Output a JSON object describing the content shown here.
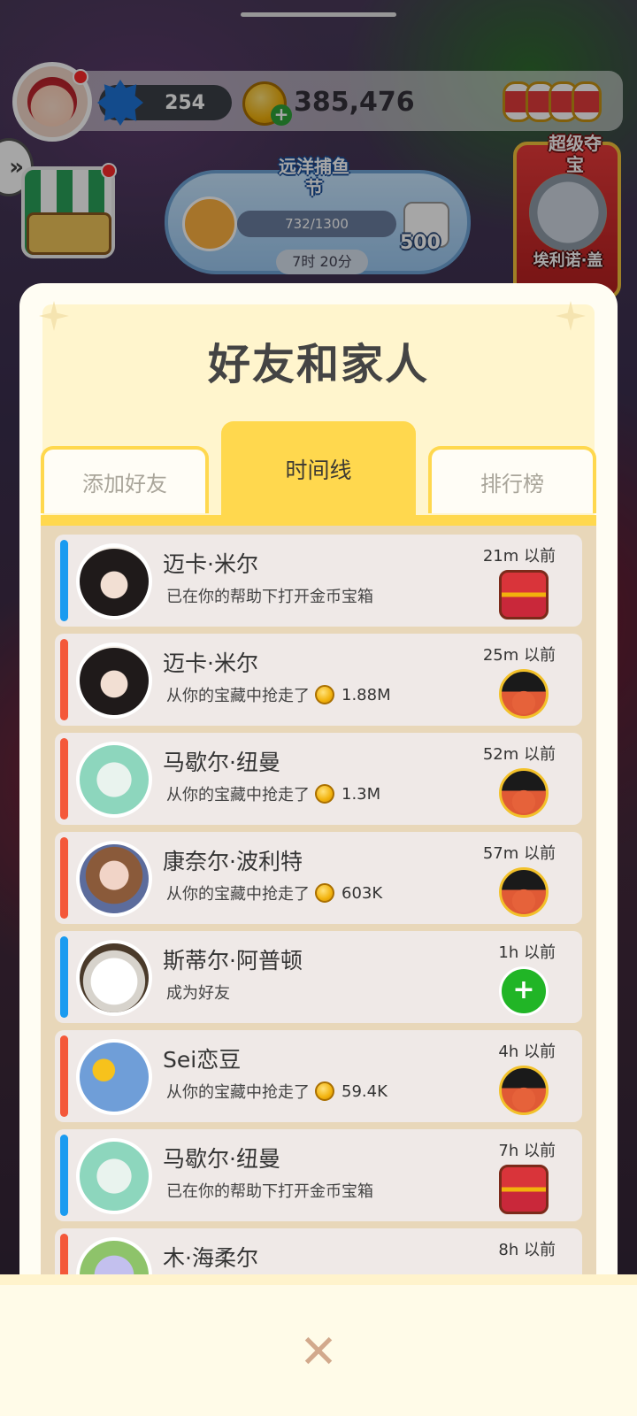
{
  "hud": {
    "level": "254",
    "coins": "385,476",
    "event": {
      "title": "远洋捕鱼节",
      "progress": "732/1300",
      "dice": "500",
      "timer": "7时 20分"
    },
    "treasure": {
      "title": "超级夺宝",
      "name": "埃利诺·盖"
    }
  },
  "modal": {
    "title": "好友和家人",
    "tabs": {
      "add_friend": "添加好友",
      "timeline": "时间线",
      "leaderboard": "排行榜"
    }
  },
  "timeline": [
    {
      "name": "迈卡·米尔",
      "desc": "已在你的帮助下打开金币宝箱",
      "amount": "",
      "time": "21m 以前",
      "stripe": "blue",
      "avatar": "av-girl",
      "badge": "chest-icon"
    },
    {
      "name": "迈卡·米尔",
      "desc": "从你的宝藏中抢走了",
      "amount": "1.88M",
      "time": "25m 以前",
      "stripe": "red",
      "avatar": "av-girl",
      "badge": "pirate-icon"
    },
    {
      "name": "马歇尔·纽曼",
      "desc": "从你的宝藏中抢走了",
      "amount": "1.3M",
      "time": "52m 以前",
      "stripe": "red",
      "avatar": "av-white",
      "badge": "pirate-icon"
    },
    {
      "name": "康奈尔·波利特",
      "desc": "从你的宝藏中抢走了",
      "amount": "603K",
      "time": "57m 以前",
      "stripe": "red",
      "avatar": "av-doll",
      "badge": "pirate-icon"
    },
    {
      "name": "斯蒂尔·阿普顿",
      "desc": "成为好友",
      "amount": "",
      "time": "1h 以前",
      "stripe": "blue",
      "avatar": "av-cat",
      "badge": "add-friend-icon"
    },
    {
      "name": "Sei恋豆",
      "desc": "从你的宝藏中抢走了",
      "amount": "59.4K",
      "time": "4h 以前",
      "stripe": "red",
      "avatar": "av-sun",
      "badge": "pirate-icon"
    },
    {
      "name": "马歇尔·纽曼",
      "desc": "已在你的帮助下打开金币宝箱",
      "amount": "",
      "time": "7h 以前",
      "stripe": "blue",
      "avatar": "av-white",
      "badge": "chest-icon"
    },
    {
      "name": "木·海柔尔",
      "desc": "",
      "amount": "",
      "time": "8h 以前",
      "stripe": "red",
      "avatar": "av-8",
      "badge": ""
    }
  ],
  "close": {
    "icon": "close-icon"
  }
}
